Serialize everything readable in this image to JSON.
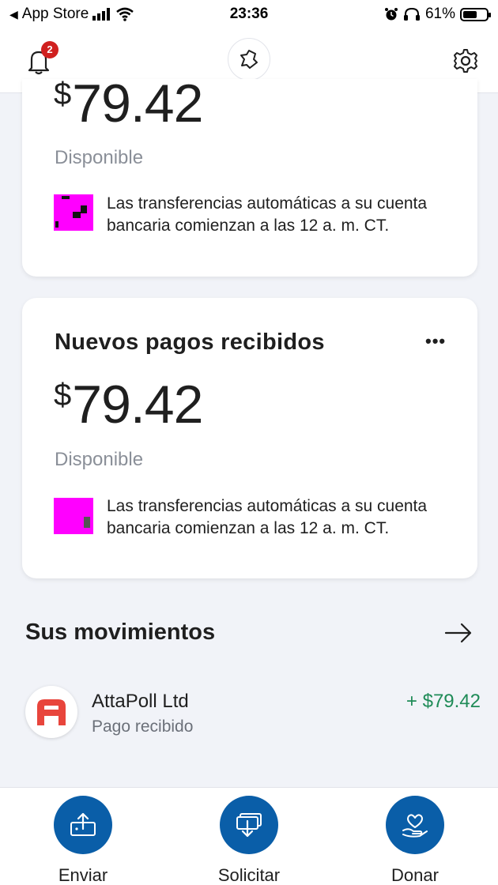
{
  "status_bar": {
    "back_label": "App Store",
    "time": "23:36",
    "battery": "61%",
    "battery_level": 0.61
  },
  "header": {
    "notification_count": "2"
  },
  "balance_card": {
    "amount": "79.42",
    "currency_symbol": "$",
    "status": "Disponible",
    "notice": "Las transferencias automáticas a su cuenta bancaria comienzan a las 12 a. m. CT."
  },
  "payments_card": {
    "title": "Nuevos pagos recibidos",
    "more_label": "•••",
    "currency_symbol": "$",
    "amount": "79.42",
    "status": "Disponible",
    "notice": "Las transferencias automáticas a su cuenta bancaria comienzan a las 12 a. m. CT."
  },
  "movements": {
    "title": "Sus movimientos",
    "items": [
      {
        "name": "AttaPoll Ltd",
        "subtitle": "Pago recibido",
        "amount": "+ $79.42"
      }
    ]
  },
  "bottom_nav": {
    "items": [
      {
        "label": "Enviar",
        "icon": "send-money-icon"
      },
      {
        "label": "Solicitar",
        "icon": "request-money-icon"
      },
      {
        "label": "Donar",
        "icon": "donate-heart-icon"
      }
    ]
  },
  "colors": {
    "accent_blue": "#0a5ea8",
    "positive_green": "#1f8b57",
    "badge_red": "#d0201f",
    "avatar_red": "#e8453c"
  }
}
